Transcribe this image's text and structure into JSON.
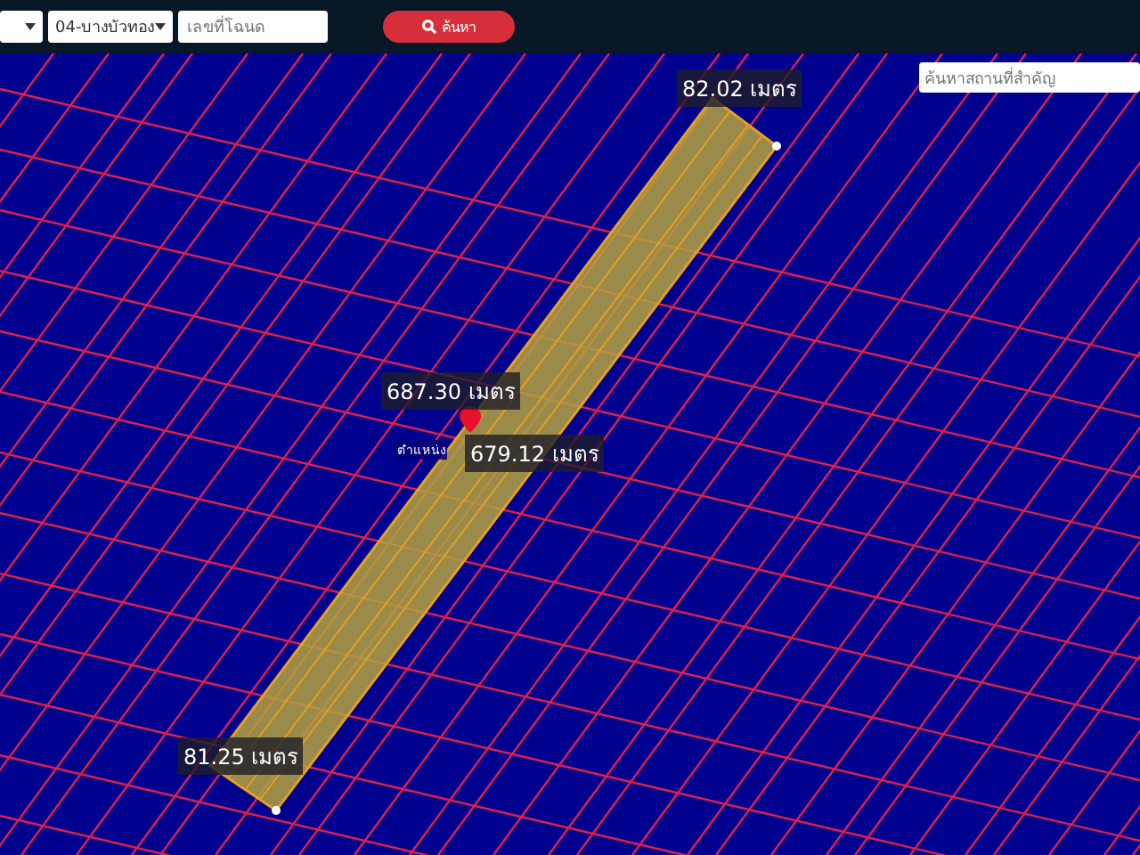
{
  "toolbar": {
    "selects": [
      {
        "value": "04-บางบัวทอง"
      }
    ],
    "deed_field": {
      "placeholder": "เลขที่โฉนด"
    },
    "search_button": {
      "label": "ค้นหา"
    }
  },
  "map": {
    "place_search": {
      "placeholder": "ค้นหาสถานที่สำคัญ"
    },
    "measurements": [
      {
        "text": "82.02 เมตร"
      },
      {
        "text": "687.30 เมตร"
      },
      {
        "text": "679.12 เมตร"
      },
      {
        "text": "81.25 เมตร"
      }
    ],
    "pin_label": "ตำแหน่ง"
  }
}
